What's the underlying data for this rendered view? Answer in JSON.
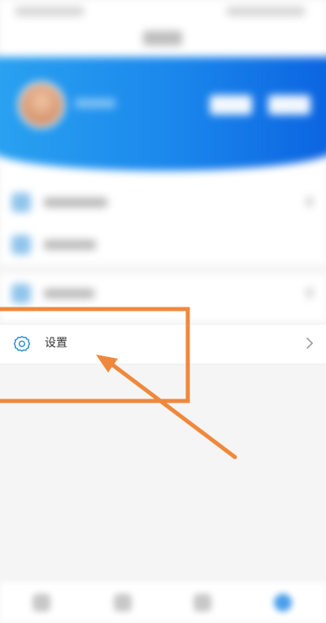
{
  "menu": {
    "settings": {
      "label": "设置",
      "icon": "gear-icon",
      "chevron_icon": "chevron-right-icon"
    }
  },
  "colors": {
    "banner_start": "#2aa2f0",
    "banner_end": "#0b63e0",
    "annotation": "#f0883c",
    "icon_accent": "#2f8fd6"
  }
}
